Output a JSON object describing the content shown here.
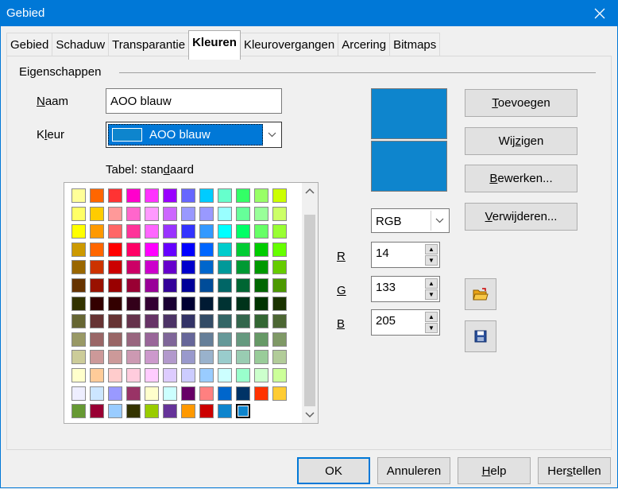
{
  "window": {
    "title": "Gebied"
  },
  "tabs": [
    "Gebied",
    "Schaduw",
    "Transparantie",
    "Kleuren",
    "Kleurovergangen",
    "Arcering",
    "Bitmaps"
  ],
  "active_tab": "Kleuren",
  "group": {
    "label": "Eigenschappen"
  },
  "naam": {
    "label_underlined": "N",
    "label_rest": "aam",
    "value": "AOO blauw"
  },
  "kleur": {
    "label_pre": "K",
    "label_underlined": "l",
    "label_rest": "eur",
    "selected": "AOO blauw",
    "swatch_color": "#0e85cd"
  },
  "table": {
    "label_pre": "Tabel: stan",
    "label_underlined": "d",
    "label_rest": "aard"
  },
  "palette_rows": [
    [
      "#ffff99",
      "#ff6600",
      "#ff3333",
      "#ff00cc",
      "#ff33ff",
      "#9900ff",
      "#6666ff",
      "#00ccff",
      "#66ffcc",
      "#33ff66",
      "#99ff66",
      "#ccff00"
    ],
    [
      "#ffff66",
      "#ffcc00",
      "#ff9999",
      "#ff66cc",
      "#ff99ff",
      "#cc66ff",
      "#9999ff",
      "#9999ff",
      "#99ffff",
      "#66ff99",
      "#99ff99",
      "#ccff66"
    ],
    [
      "#ffff00",
      "#ff9900",
      "#ff6666",
      "#ff3399",
      "#ff66ff",
      "#9933ff",
      "#3333ff",
      "#3399ff",
      "#00ffff",
      "#00ff66",
      "#66ff66",
      "#99ff33"
    ],
    [
      "#cc9900",
      "#ff6600",
      "#ff0000",
      "#ff0066",
      "#ff00ff",
      "#6600ff",
      "#0000ff",
      "#0066ff",
      "#00cccc",
      "#00cc33",
      "#00cc00",
      "#66ff00"
    ],
    [
      "#996600",
      "#cc3300",
      "#cc0000",
      "#cc0066",
      "#cc00cc",
      "#6600cc",
      "#0000cc",
      "#0066cc",
      "#009999",
      "#009933",
      "#009900",
      "#66cc00"
    ],
    [
      "#663300",
      "#991100",
      "#990000",
      "#990033",
      "#990099",
      "#330099",
      "#000099",
      "#004c99",
      "#006666",
      "#006633",
      "#006600",
      "#4c9900"
    ],
    [
      "#333300",
      "#330000",
      "#330000",
      "#33001a",
      "#330033",
      "#1a0033",
      "#000033",
      "#001a33",
      "#003333",
      "#00331a",
      "#003300",
      "#1a3300"
    ],
    [
      "#666633",
      "#663333",
      "#663333",
      "#66334c",
      "#663366",
      "#4c3366",
      "#333366",
      "#334c66",
      "#336666",
      "#33664c",
      "#336633",
      "#4c6633"
    ],
    [
      "#999966",
      "#996666",
      "#996666",
      "#99667f",
      "#996699",
      "#7f6699",
      "#666699",
      "#667f99",
      "#669999",
      "#66997f",
      "#669966",
      "#7f9966"
    ],
    [
      "#cccc99",
      "#cc9999",
      "#cc9999",
      "#cc99b2",
      "#cc99cc",
      "#b299cc",
      "#9999cc",
      "#99b2cc",
      "#99cccc",
      "#99ccb2",
      "#99cc99",
      "#b2cc99"
    ],
    [
      "#ffffcc",
      "#ffcc99",
      "#ffcccc",
      "#ffccdd",
      "#ffccff",
      "#ddccff",
      "#ccccff",
      "#99ccff",
      "#ccffff",
      "#99ffcc",
      "#ccffcc",
      "#ccff99"
    ],
    [
      "#eeeeff",
      "#cce6ff",
      "#9999ff",
      "#993366",
      "#ffffcc",
      "#ccffff",
      "#660066",
      "#ff8080",
      "#0066cc",
      "#003366",
      "#ff3300",
      "#ffcc33"
    ],
    [
      "#669933",
      "#990033",
      "#99ccff",
      "#333300",
      "#99cc00",
      "#663399",
      "#ff9900",
      "#cc0000",
      "#0e85cd",
      "#0e85cd"
    ]
  ],
  "selected_swatch": "AOO blauw",
  "buttons": {
    "toevoegen": {
      "u": "T",
      "rest": "oevoegen"
    },
    "wijzigen": {
      "pre": "Wij",
      "u": "z",
      "rest": "igen"
    },
    "bewerken": {
      "u": "B",
      "rest": "ewerken..."
    },
    "verwijderen": {
      "u": "V",
      "rest": "erwijderen..."
    }
  },
  "mode": {
    "selected": "RGB"
  },
  "rgb": {
    "r": {
      "label": "R",
      "value": "14"
    },
    "g": {
      "label": "G",
      "value": "133"
    },
    "b": {
      "label": "B",
      "value": "205"
    }
  },
  "preview": {
    "old_color": "#0e85cd",
    "new_color": "#0e85cd"
  },
  "icons": {
    "load": "open-folder-icon",
    "save": "save-disk-icon"
  },
  "footer": {
    "ok": "OK",
    "cancel": "Annuleren",
    "help_u": "H",
    "help_rest": "elp",
    "reset_pre": "Her",
    "reset_u": "s",
    "reset_rest": "tellen"
  }
}
